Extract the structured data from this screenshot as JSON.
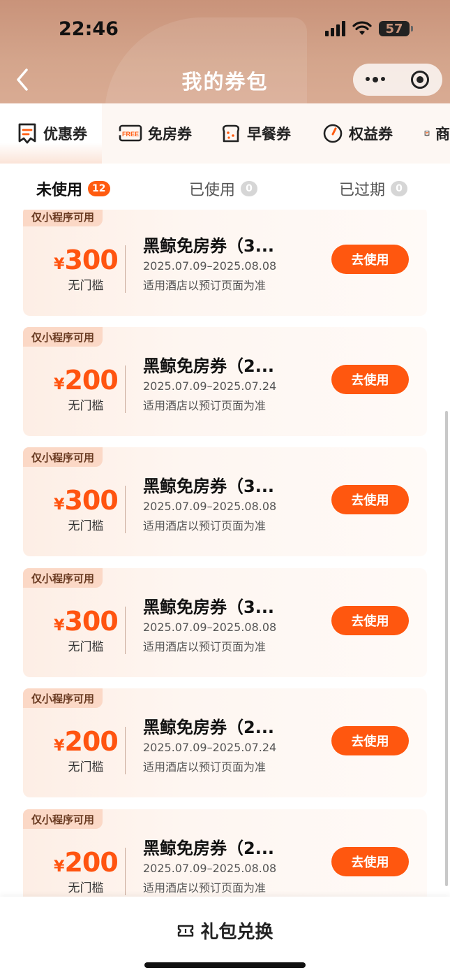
{
  "status_bar": {
    "time": "22:46",
    "battery": "57"
  },
  "nav": {
    "title": "我的券包"
  },
  "categories": [
    {
      "label": "优惠券",
      "icon": "coupon-icon"
    },
    {
      "label": "免房券",
      "icon": "free-room-icon"
    },
    {
      "label": "早餐券",
      "icon": "bread-icon"
    },
    {
      "label": "权益券",
      "icon": "gauge-icon"
    },
    {
      "label": "商",
      "icon": "coupon-icon"
    }
  ],
  "status_tabs": [
    {
      "label": "未使用",
      "count": "12"
    },
    {
      "label": "已使用",
      "count": "0"
    },
    {
      "label": "已过期",
      "count": "0"
    }
  ],
  "coupons": [
    {
      "tag": "仅小程序可用",
      "currency": "¥",
      "amount": "300",
      "threshold": "无门槛",
      "title": "黑鲸免房券（3...",
      "date": "2025.07.09–2025.08.08",
      "note": "适用酒店以预订页面为准",
      "button": "去使用"
    },
    {
      "tag": "仅小程序可用",
      "currency": "¥",
      "amount": "200",
      "threshold": "无门槛",
      "title": "黑鲸免房券（2...",
      "date": "2025.07.09–2025.07.24",
      "note": "适用酒店以预订页面为准",
      "button": "去使用"
    },
    {
      "tag": "仅小程序可用",
      "currency": "¥",
      "amount": "300",
      "threshold": "无门槛",
      "title": "黑鲸免房券（3...",
      "date": "2025.07.09–2025.08.08",
      "note": "适用酒店以预订页面为准",
      "button": "去使用"
    },
    {
      "tag": "仅小程序可用",
      "currency": "¥",
      "amount": "300",
      "threshold": "无门槛",
      "title": "黑鲸免房券（3...",
      "date": "2025.07.09–2025.08.08",
      "note": "适用酒店以预订页面为准",
      "button": "去使用"
    },
    {
      "tag": "仅小程序可用",
      "currency": "¥",
      "amount": "200",
      "threshold": "无门槛",
      "title": "黑鲸免房券（2...",
      "date": "2025.07.09–2025.07.24",
      "note": "适用酒店以预订页面为准",
      "button": "去使用"
    },
    {
      "tag": "仅小程序可用",
      "currency": "¥",
      "amount": "200",
      "threshold": "无门槛",
      "title": "黑鲸免房券（2...",
      "date": "2025.07.09–2025.08.08",
      "note": "适用酒店以预订页面为准",
      "button": "去使用"
    }
  ],
  "bottom": {
    "gift_label": "礼包兑换"
  },
  "colors": {
    "accent": "#ff570f",
    "header": "#c9937a",
    "card": "#fef3ec"
  }
}
